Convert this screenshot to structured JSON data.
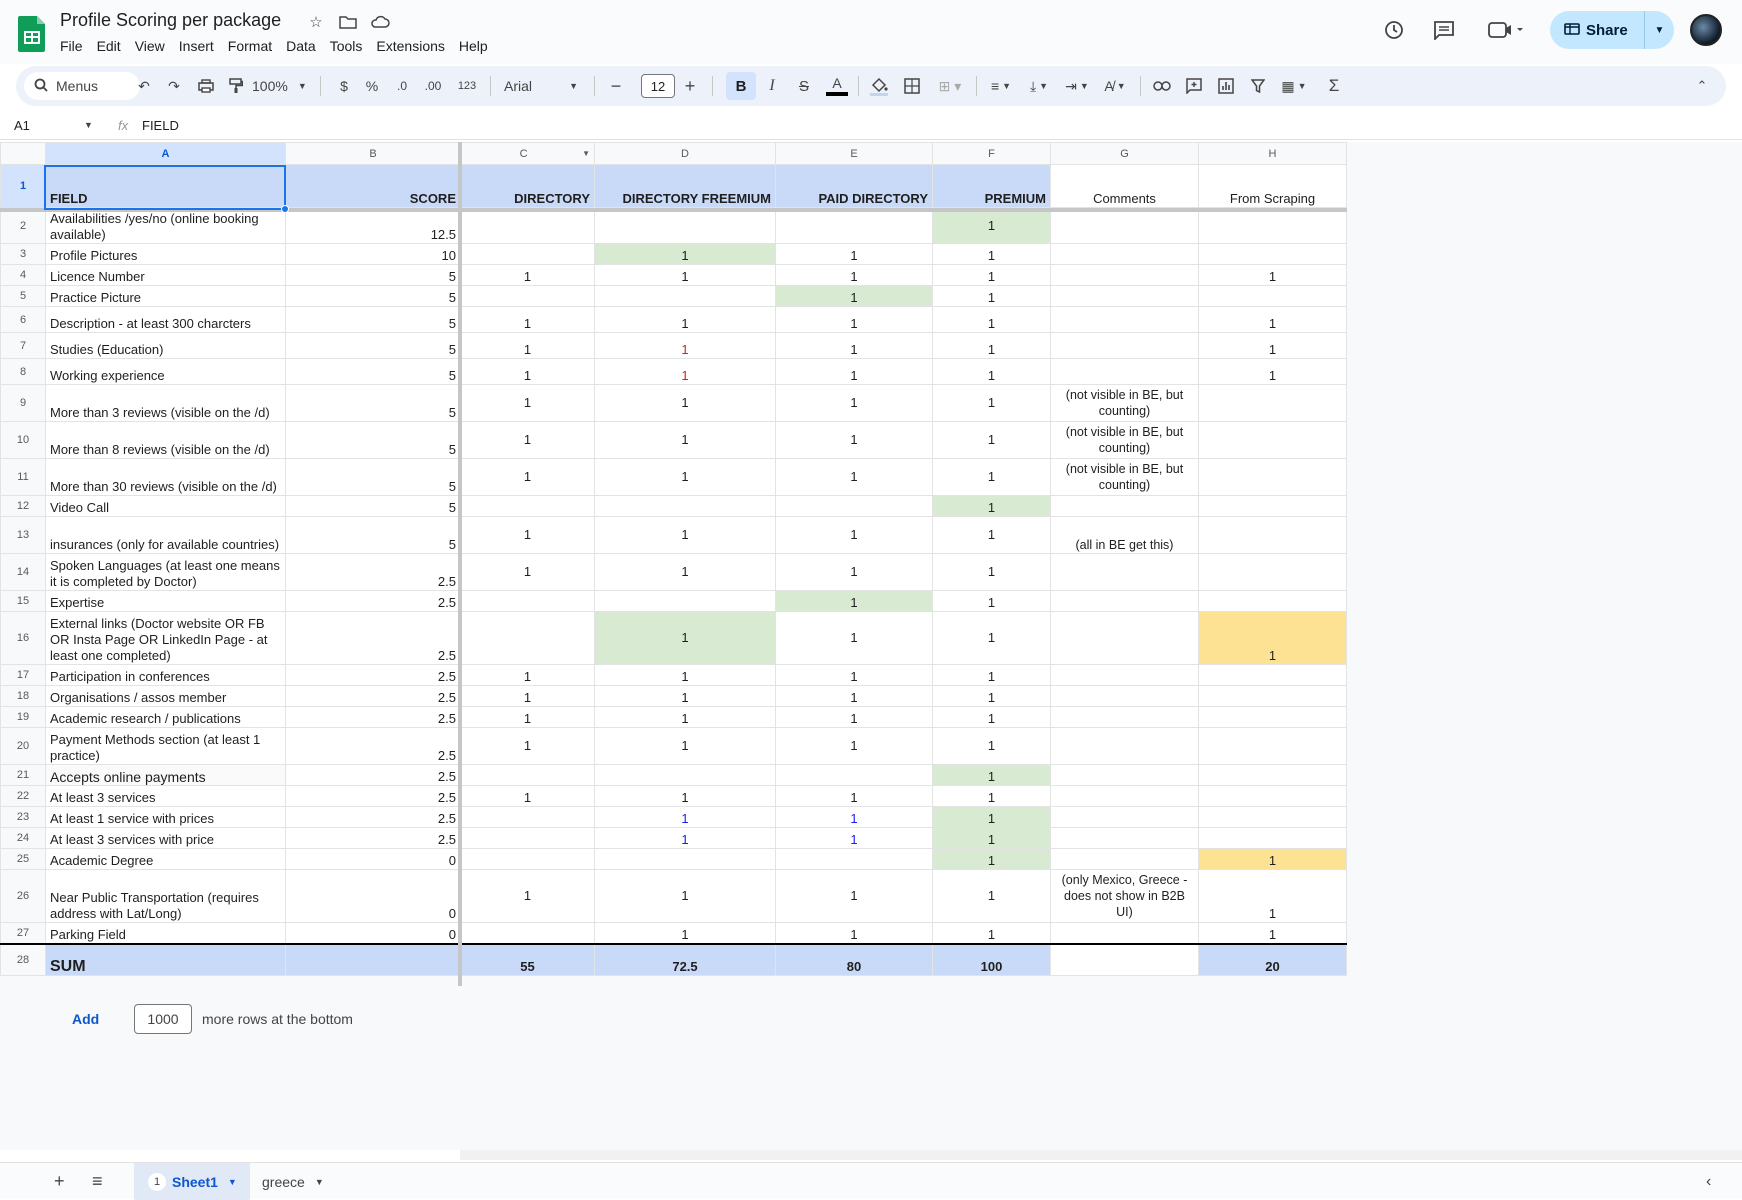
{
  "app": {
    "title": "Profile Scoring  per package",
    "menu": [
      "File",
      "Edit",
      "View",
      "Insert",
      "Format",
      "Data",
      "Tools",
      "Extensions",
      "Help"
    ],
    "share_label": "Share",
    "brand_color": "#0f9d58",
    "accent_color": "#c2e7ff"
  },
  "toolbar": {
    "search_label": "Menus",
    "zoom": "100%",
    "currency": "$",
    "percent": "%",
    "dec_decrease": ".0",
    "dec_increase": ".00",
    "number_format": "123",
    "font": "Arial",
    "font_size": "12",
    "bold": "B",
    "italic": "I",
    "text_color": "A"
  },
  "formula_bar": {
    "cell_ref": "A1",
    "fx": "fx",
    "value": "FIELD"
  },
  "columns": [
    "A",
    "B",
    "C",
    "D",
    "E",
    "F",
    "G",
    "H"
  ],
  "header_row": {
    "field": "FIELD",
    "score": "SCORE",
    "directory": "DIRECTORY",
    "directory_freemium": "DIRECTORY FREEMIUM",
    "paid_directory": "PAID  DIRECTORY",
    "premium": "PREMIUM",
    "comments": "Comments",
    "from_scraping": "From Scraping"
  },
  "rows": [
    {
      "n": "2",
      "field": "Availabilities /yes/no (online booking available)",
      "score": "12.5",
      "c": "",
      "d": "",
      "e": "",
      "f": "1",
      "g": "",
      "h": ""
    },
    {
      "n": "3",
      "field": "Profile Pictures",
      "score": "10",
      "c": "",
      "d": "1",
      "e": "1",
      "f": "1",
      "g": "",
      "h": ""
    },
    {
      "n": "4",
      "field": "Licence Number",
      "score": "5",
      "c": "1",
      "d": "1",
      "e": "1",
      "f": "1",
      "g": "",
      "h": "1"
    },
    {
      "n": "5",
      "field": "Practice Picture",
      "score": "5",
      "c": "",
      "d": "",
      "e": "1",
      "f": "1",
      "g": "",
      "h": ""
    },
    {
      "n": "6",
      "field": "Description - at least 300 charcters",
      "score": "5",
      "c": "1",
      "d": "1",
      "e": "1",
      "f": "1",
      "g": "",
      "h": "1"
    },
    {
      "n": "7",
      "field": "Studies (Education)",
      "score": "5",
      "c": "1",
      "d": "1",
      "e": "1",
      "f": "1",
      "g": "",
      "h": "1"
    },
    {
      "n": "8",
      "field": "Working experience",
      "score": "5",
      "c": "1",
      "d": "1",
      "e": "1",
      "f": "1",
      "g": "",
      "h": "1"
    },
    {
      "n": "9",
      "field": "More than 3 reviews (visible on the /d)",
      "score": "5",
      "c": "1",
      "d": "1",
      "e": "1",
      "f": "1",
      "g": "(not visible in BE, but counting)",
      "h": ""
    },
    {
      "n": "10",
      "field": "More than 8 reviews (visible on the /d)",
      "score": "5",
      "c": "1",
      "d": "1",
      "e": "1",
      "f": "1",
      "g": "(not visible in BE, but counting)",
      "h": ""
    },
    {
      "n": "11",
      "field": "More than 30 reviews (visible on the /d)",
      "score": "5",
      "c": "1",
      "d": "1",
      "e": "1",
      "f": "1",
      "g": "(not visible in BE, but counting)",
      "h": ""
    },
    {
      "n": "12",
      "field": "Video Call",
      "score": "5",
      "c": "",
      "d": "",
      "e": "",
      "f": "1",
      "g": "",
      "h": ""
    },
    {
      "n": "13",
      "field": "insurances (only for available countries)",
      "score": "5",
      "c": "1",
      "d": "1",
      "e": "1",
      "f": "1",
      "g": "(all in BE get this)",
      "h": ""
    },
    {
      "n": "14",
      "field": "Spoken Languages (at least one means it is completed by Doctor)",
      "score": "2.5",
      "c": "1",
      "d": "1",
      "e": "1",
      "f": "1",
      "g": "",
      "h": ""
    },
    {
      "n": "15",
      "field": "Expertise",
      "score": "2.5",
      "c": "",
      "d": "",
      "e": "1",
      "f": "1",
      "g": "",
      "h": ""
    },
    {
      "n": "16",
      "field": "External links (Doctor website OR FB OR Insta Page OR LinkedIn Page - at least one completed)",
      "score": "2.5",
      "c": "",
      "d": "1",
      "e": "1",
      "f": "1",
      "g": "",
      "h": "1"
    },
    {
      "n": "17",
      "field": "Participation in conferences",
      "score": "2.5",
      "c": "1",
      "d": "1",
      "e": "1",
      "f": "1",
      "g": "",
      "h": ""
    },
    {
      "n": "18",
      "field": "Organisations / assos member",
      "score": "2.5",
      "c": "1",
      "d": "1",
      "e": "1",
      "f": "1",
      "g": "",
      "h": ""
    },
    {
      "n": "19",
      "field": "Academic research / publications",
      "score": "2.5",
      "c": "1",
      "d": "1",
      "e": "1",
      "f": "1",
      "g": "",
      "h": ""
    },
    {
      "n": "20",
      "field": "Payment Methods section (at least 1 practice)",
      "score": "2.5",
      "c": "1",
      "d": "1",
      "e": "1",
      "f": "1",
      "g": "",
      "h": ""
    },
    {
      "n": "21",
      "field": "Accepts online payments",
      "score": "2.5",
      "c": "",
      "d": "",
      "e": "",
      "f": "1",
      "g": "",
      "h": ""
    },
    {
      "n": "22",
      "field": "At least 3 services",
      "score": "2.5",
      "c": "1",
      "d": "1",
      "e": "1",
      "f": "1",
      "g": "",
      "h": ""
    },
    {
      "n": "23",
      "field": "At least 1 service with prices",
      "score": "2.5",
      "c": "",
      "d": "1",
      "e": "1",
      "f": "1",
      "g": "",
      "h": ""
    },
    {
      "n": "24",
      "field": "At least 3 services with price",
      "score": "2.5",
      "c": "",
      "d": "1",
      "e": "1",
      "f": "1",
      "g": "",
      "h": ""
    },
    {
      "n": "25",
      "field": "Academic Degree",
      "score": "0",
      "c": "",
      "d": "",
      "e": "",
      "f": "1",
      "g": "",
      "h": "1"
    },
    {
      "n": "26",
      "field": "Near Public Transportation (requires address with Lat/Long)",
      "score": "0",
      "c": "1",
      "d": "1",
      "e": "1",
      "f": "1",
      "g": "(only Mexico, Greece - does not show in B2B UI)",
      "h": "1"
    },
    {
      "n": "27",
      "field": "Parking Field",
      "score": "0",
      "c": "",
      "d": "1",
      "e": "1",
      "f": "1",
      "g": "",
      "h": "1"
    }
  ],
  "sum_row": {
    "label": "SUM",
    "c": "55",
    "d": "72.5",
    "e": "80",
    "f": "100",
    "h": "20"
  },
  "add_rows": {
    "button": "Add",
    "count": "1000",
    "suffix": "more rows at the bottom"
  },
  "sheets": {
    "active": "Sheet1",
    "active_badge": "1",
    "other": "greece"
  }
}
